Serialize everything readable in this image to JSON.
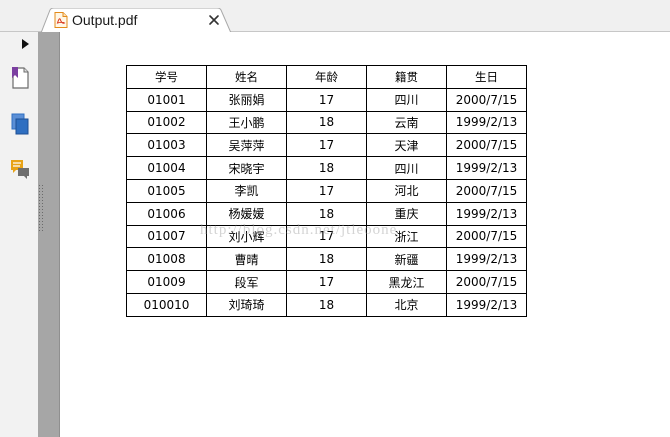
{
  "tab": {
    "title": "Output.pdf"
  },
  "watermark": "http://blog.csdn.net/jtleoone",
  "table": {
    "headers": [
      "学号",
      "姓名",
      "年龄",
      "籍贯",
      "生日"
    ],
    "rows": [
      [
        "01001",
        "张丽娟",
        "17",
        "四川",
        "2000/7/15"
      ],
      [
        "01002",
        "王小鹏",
        "18",
        "云南",
        "1999/2/13"
      ],
      [
        "01003",
        "吴萍萍",
        "17",
        "天津",
        "2000/7/15"
      ],
      [
        "01004",
        "宋晓宇",
        "18",
        "四川",
        "1999/2/13"
      ],
      [
        "01005",
        "李凯",
        "17",
        "河北",
        "2000/7/15"
      ],
      [
        "01006",
        "杨媛媛",
        "18",
        "重庆",
        "1999/2/13"
      ],
      [
        "01007",
        "刘小辉",
        "17",
        "浙江",
        "2000/7/15"
      ],
      [
        "01008",
        "曹晴",
        "18",
        "新疆",
        "1999/2/13"
      ],
      [
        "01009",
        "段军",
        "17",
        "黑龙江",
        "2000/7/15"
      ],
      [
        "010010",
        "刘琦琦",
        "18",
        "北京",
        "1999/2/13"
      ]
    ]
  },
  "icons": {
    "tab_file": "pdf-file-icon",
    "close": "close-icon",
    "toggle": "expand-triangle-icon",
    "bookmarks": "bookmark-page-icon",
    "pages": "page-thumbnails-icon",
    "comments": "comments-icon"
  },
  "colors": {
    "bookmark": "#7b3fa0",
    "pages": "#2f6fc1",
    "comments": "#e8a317"
  }
}
